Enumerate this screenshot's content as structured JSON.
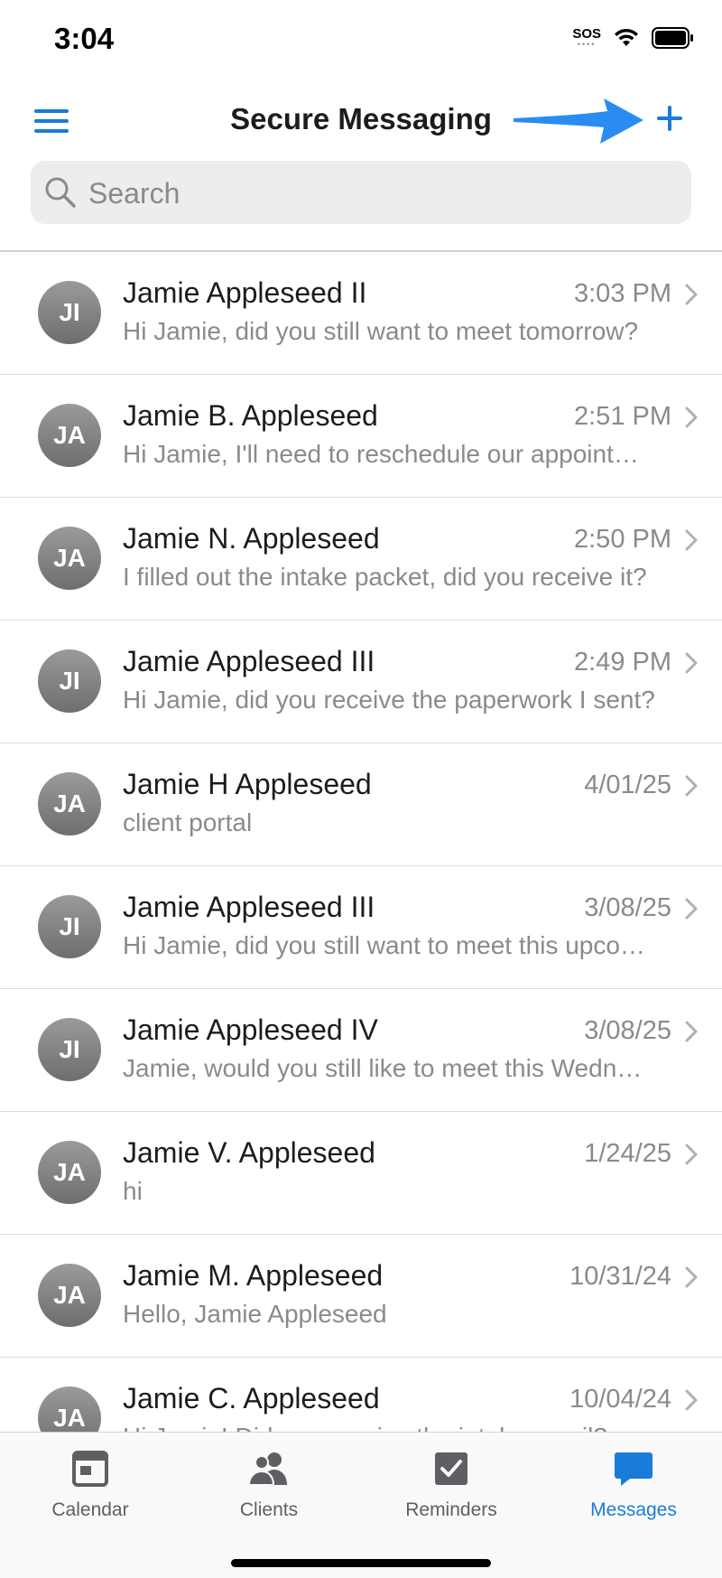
{
  "status_bar": {
    "time": "3:04",
    "sos": "SOS"
  },
  "header": {
    "title": "Secure Messaging"
  },
  "search": {
    "placeholder": "Search"
  },
  "conversations": [
    {
      "initials": "JI",
      "name": "Jamie Appleseed II",
      "time": "3:03 PM",
      "preview": "Hi Jamie, did you still want to meet tomorrow?"
    },
    {
      "initials": "JA",
      "name": "Jamie B. Appleseed",
      "time": "2:51 PM",
      "preview": "Hi Jamie, I'll need to reschedule our appointment"
    },
    {
      "initials": "JA",
      "name": "Jamie N. Appleseed",
      "time": "2:50 PM",
      "preview": "I filled out the intake packet, did you receive it?"
    },
    {
      "initials": "JI",
      "name": "Jamie Appleseed III",
      "time": "2:49 PM",
      "preview": "Hi Jamie, did you receive the paperwork I sent?"
    },
    {
      "initials": "JA",
      "name": "Jamie H Appleseed",
      "time": "4/01/25",
      "preview": "client portal"
    },
    {
      "initials": "JI",
      "name": "Jamie Appleseed III",
      "time": "3/08/25",
      "preview": "Hi Jamie, did you still want to meet this upcoming week?"
    },
    {
      "initials": "JI",
      "name": "Jamie Appleseed IV",
      "time": "3/08/25",
      "preview": "Jamie, would you still like to meet this Wednesday?"
    },
    {
      "initials": "JA",
      "name": "Jamie V. Appleseed",
      "time": "1/24/25",
      "preview": "hi"
    },
    {
      "initials": "JA",
      "name": "Jamie M. Appleseed",
      "time": "10/31/24",
      "preview": "Hello, Jamie Appleseed"
    },
    {
      "initials": "JA",
      "name": "Jamie C. Appleseed",
      "time": "10/04/24",
      "preview": "Hi Jamie! Did you receive the intake email?"
    }
  ],
  "tabs": [
    {
      "label": "Calendar",
      "icon": "calendar-icon",
      "active": false
    },
    {
      "label": "Clients",
      "icon": "clients-icon",
      "active": false
    },
    {
      "label": "Reminders",
      "icon": "reminders-icon",
      "active": false
    },
    {
      "label": "Messages",
      "icon": "messages-icon",
      "active": true
    }
  ],
  "colors": {
    "accent": "#1a7bd8",
    "annotation_arrow": "#2a8cf0",
    "inactive": "#5f5f63"
  }
}
